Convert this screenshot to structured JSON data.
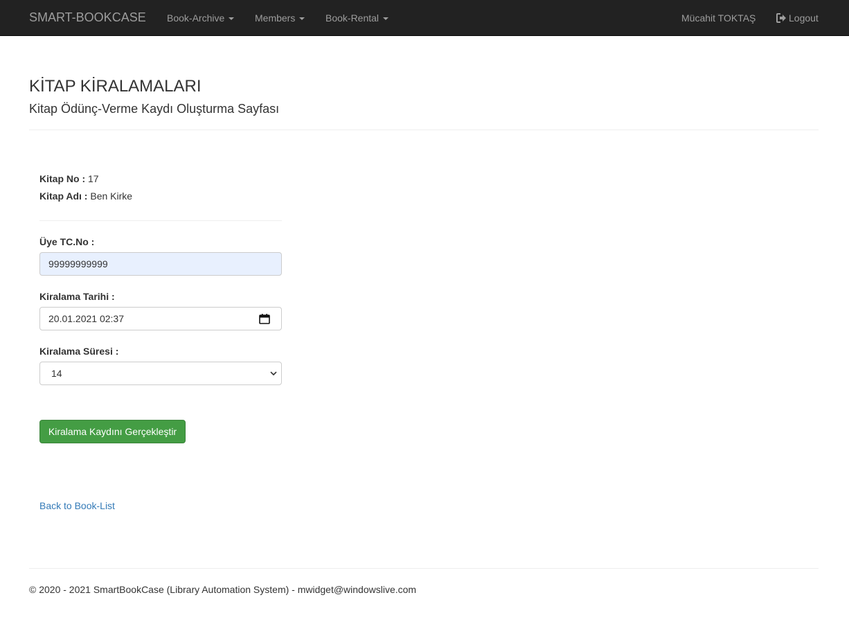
{
  "navbar": {
    "brand": "SMART-BOOKCASE",
    "menus": [
      {
        "label": "Book-Archive"
      },
      {
        "label": "Members"
      },
      {
        "label": "Book-Rental"
      }
    ],
    "user": "Mücahit TOKTAŞ",
    "logout": "Logout"
  },
  "page": {
    "title": "KİTAP KİRALAMALARI",
    "subtitle": "Kitap Ödünç-Verme Kaydı Oluşturma Sayfası"
  },
  "book": {
    "no_label": "Kitap No :",
    "no_value": "17",
    "name_label": "Kitap Adı :",
    "name_value": "Ben Kirke"
  },
  "form": {
    "member_label": "Üye TC.No :",
    "member_value": "99999999999",
    "date_label": "Kiralama Tarihi :",
    "date_value": "20.01.2021 02:37",
    "duration_label": "Kiralama Süresi :",
    "duration_value": "14",
    "submit_label": "Kiralama Kaydını Gerçekleştir"
  },
  "back_link": "Back to Book-List",
  "footer": "© 2020 - 2021 SmartBookCase (Library Automation System) - mwidget@windowslive.com",
  "colors": {
    "navbar_bg": "#222222",
    "button_green": "#449d44",
    "link_blue": "#337ab7",
    "autofill_bg": "#e8f0fe"
  }
}
